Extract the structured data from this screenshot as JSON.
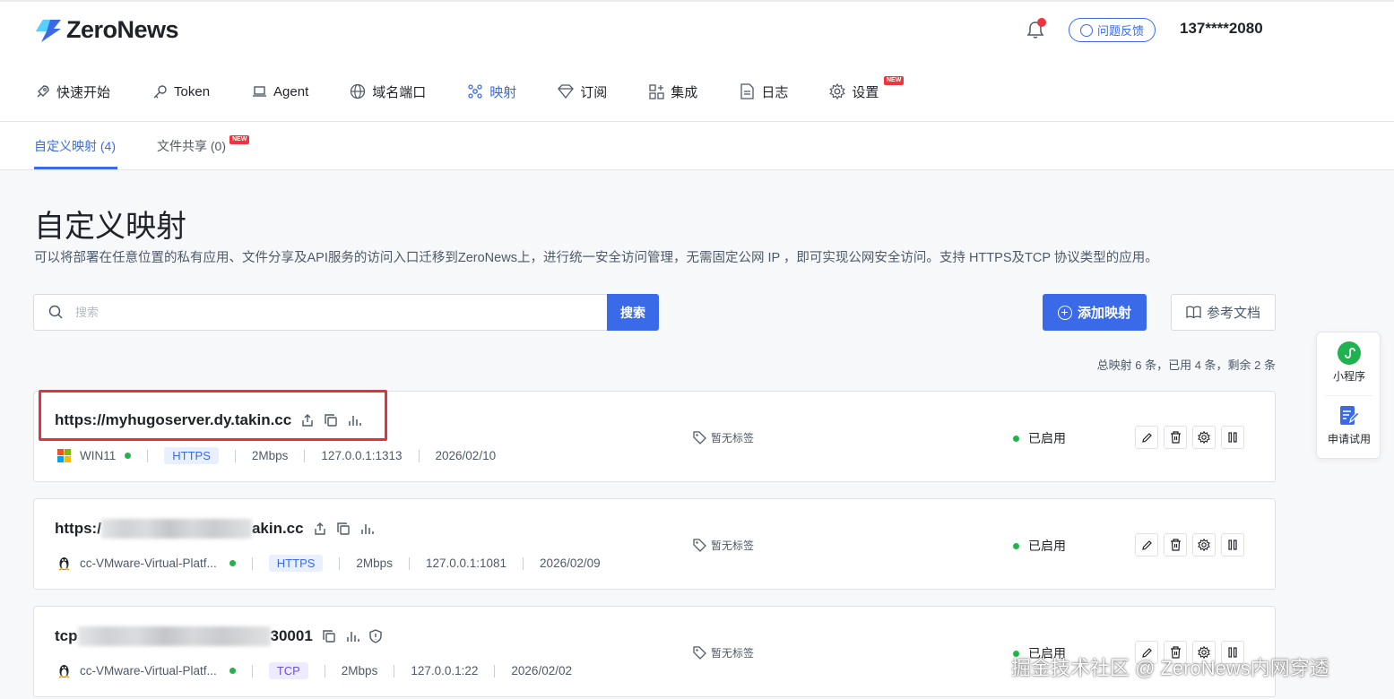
{
  "header": {
    "logo_text": "ZeroNews",
    "feedback_label": "问题反馈",
    "user": "137****2080"
  },
  "nav": [
    {
      "label": "快速开始",
      "icon": "rocket-icon"
    },
    {
      "label": "Token",
      "icon": "key-icon"
    },
    {
      "label": "Agent",
      "icon": "laptop-icon"
    },
    {
      "label": "域名端口",
      "icon": "globe-icon"
    },
    {
      "label": "映射",
      "icon": "network-icon",
      "active": true
    },
    {
      "label": "订阅",
      "icon": "diamond-icon"
    },
    {
      "label": "集成",
      "icon": "grid-plus-icon"
    },
    {
      "label": "日志",
      "icon": "document-icon"
    },
    {
      "label": "设置",
      "icon": "gear-icon",
      "badge": "NEW"
    }
  ],
  "subtabs": {
    "custom": "自定义映射 (4)",
    "file_share": "文件共享 (0)",
    "file_share_badge": "NEW"
  },
  "page": {
    "title": "自定义映射",
    "description": "可以将部署在任意位置的私有应用、文件分享及API服务的访问入口迁移到ZeroNews上，进行统一安全访问管理，无需固定公网 IP ，即可实现公网安全访问。支持 HTTPS及TCP 协议类型的应用。"
  },
  "search": {
    "placeholder": "搜索",
    "button": "搜索"
  },
  "buttons": {
    "add": "添加映射",
    "docs": "参考文档"
  },
  "summary": "总映射 6 条，已用 4 条，剩余 2 条",
  "mappings": [
    {
      "url": "https://myhugoserver.dy.takin.cc",
      "url_prefix": "",
      "url_suffix": "",
      "os_icon": "windows-icon",
      "agent": "WIN11",
      "protocol": "HTTPS",
      "bandwidth": "2Mbps",
      "target": "127.0.0.1:1313",
      "date": "2026/02/10",
      "tag": "暂无标签",
      "status": "已启用"
    },
    {
      "url": "",
      "url_prefix": "https:/",
      "url_suffix": "akin.cc",
      "os_icon": "linux-icon",
      "agent": "cc-VMware-Virtual-Platf...",
      "protocol": "HTTPS",
      "bandwidth": "2Mbps",
      "target": "127.0.0.1:1081",
      "date": "2026/02/09",
      "tag": "暂无标签",
      "status": "已启用"
    },
    {
      "url": "",
      "url_prefix": "tcp",
      "url_suffix": "30001",
      "os_icon": "linux-icon",
      "agent": "cc-VMware-Virtual-Platf...",
      "protocol": "TCP",
      "bandwidth": "2Mbps",
      "target": "127.0.0.1:22",
      "date": "2026/02/02",
      "tag": "暂无标签",
      "status": "已启用"
    }
  ],
  "side_panel": {
    "mini_program": "小程序",
    "apply_trial": "申请试用"
  },
  "watermark": "掘金技术社区 @ ZeroNews内网穿透",
  "colors": {
    "accent": "#3a6ae8",
    "status_green": "#23b24b",
    "highlight_red": "#e4323a"
  }
}
